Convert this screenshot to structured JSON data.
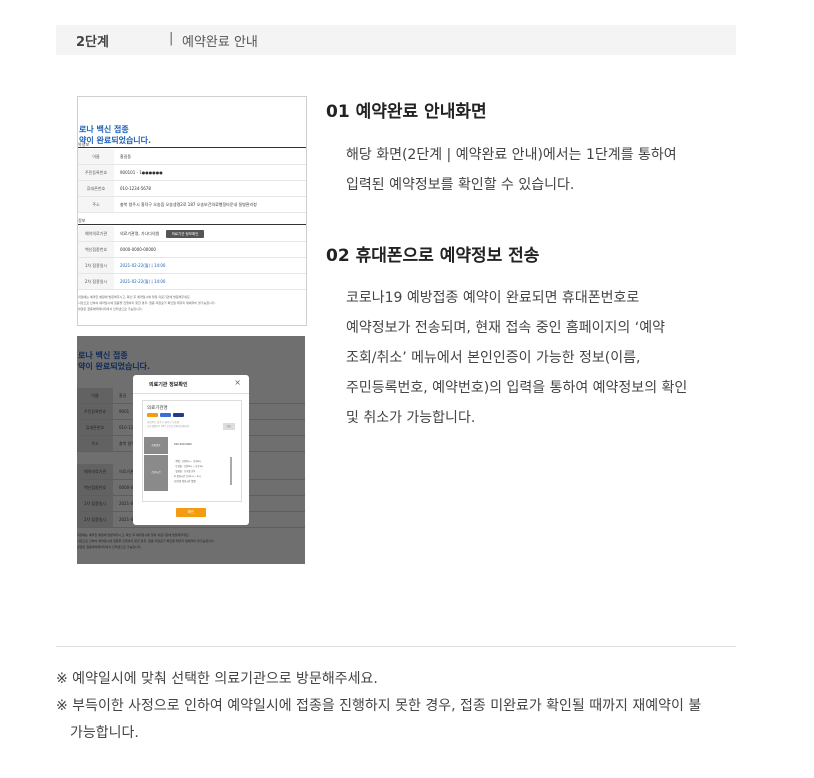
{
  "step": {
    "label": "2단계",
    "separator": "|",
    "title": "예약완료 안내"
  },
  "shot1": {
    "headline": [
      "로나 백신 접종",
      "약이 완료되었습니다."
    ],
    "section1": "약정보",
    "rows1": [
      {
        "label": "이름",
        "value": "홍길동"
      },
      {
        "label": "주민등록번호",
        "value": "900101 - 1●●●●●●"
      },
      {
        "label": "휴대폰번호",
        "value": "010-1234-5678"
      },
      {
        "label": "주소",
        "value": "충북 청주시 흥덕구 오송읍 오송생명2로 187 오송보건의료행정타운내 질병관리청"
      }
    ],
    "section2": "정보",
    "rows2": [
      {
        "label": "예약의료기관",
        "value": "의료기관명, 가나다의원"
      },
      {
        "label": "백신접종번호",
        "value": "0000-0000-00000"
      },
      {
        "label": "1차 접종일시",
        "value": "2021-02-22(월) | 14:00"
      },
      {
        "label": "2차 접종일시",
        "value": "2021-02-22(월) | 14:00"
      }
    ],
    "button": "의료기관 정보확인",
    "notes": [
      "의일에는 예약한 병원에 방문해주시고, 확인 후 예약일시에 맞춰 의료기관에 방문해주세요.",
      "사정으로 인하여 예약일시에 접종을 진행하지 못한 경우, 접종 미완료가 확인될 때까지 재예약이 불가능합니다.",
      "변경은 접종예약페이지에서 인터넷으로 가능합니다."
    ]
  },
  "shot2": {
    "headline": [
      "로나 백신 접종",
      "약이 완료되었습니다."
    ],
    "rows": [
      {
        "label": "이름",
        "value": "홍길"
      },
      {
        "label": "주민등록번호",
        "value": "9001"
      },
      {
        "label": "휴대폰번호",
        "value": "010-1234"
      },
      {
        "label": "주소",
        "value": "충북 청주"
      },
      {
        "label": "예약의료기관",
        "value": "의료기관"
      },
      {
        "label": "백신접종번호",
        "value": "0000-00"
      },
      {
        "label": "1차 접종일시",
        "value": "2021-0"
      },
      {
        "label": "2차 접종일시",
        "value": "2021-0"
      }
    ],
    "modal": {
      "title": "의료기관 정보확인",
      "close": "×",
      "hospital": "의료기관명",
      "address": [
        "충청북도 청주시 흥덕구 오송읍",
        "오송생명2로 187 오송보건의료행정타운"
      ],
      "map_button": "지도",
      "photo": "진료시간",
      "phone_label": "전화번호",
      "phone": "043-200-0000",
      "hours": [
        "· 평일 : 오전9시 ~ 오후6시",
        "· 토요일 : 오전9시 ~ 오후1시",
        "· 일요일 : 오후일 휴무",
        "※ 점심시간 오후1시 ~ 2시",
        "(휴진일 점심시간 없음)"
      ],
      "ok": "확인"
    }
  },
  "section01": {
    "title": "01 예약완료 안내화면",
    "lines": [
      "해당 화면(2단계 | 예약완료 안내)에서는 1단계를 통하여",
      "입력된 예약정보를 확인할 수 있습니다."
    ]
  },
  "section02": {
    "title": "02 휴대폰으로 예약정보 전송",
    "lines": [
      "코로나19 예방접종 예약이 완료되면 휴대폰번호로",
      "예약정보가 전송되며, 현재 접속 중인 홈페이지의 ‘예약",
      "조회/취소’ 메뉴에서 본인인증이 가능한 정보(이름,",
      "주민등록번호, 예약번호)의 입력을 통하여 예약정보의 확인",
      "및 취소가 가능합니다."
    ]
  },
  "footer": {
    "notes": [
      "※ 예약일시에 맞춰 선택한 의료기관으로 방문해주세요.",
      "※ 부득이한 사정으로 인하여 예약일시에 접종을 진행하지 못한 경우, 접종 미완료가 확인될 때까지 재예약이 불",
      "가능합니다."
    ]
  },
  "colors": {
    "accent_blue": "#1b5fb8",
    "orange": "#f39c12",
    "step_bg": "#f4f4f4"
  }
}
